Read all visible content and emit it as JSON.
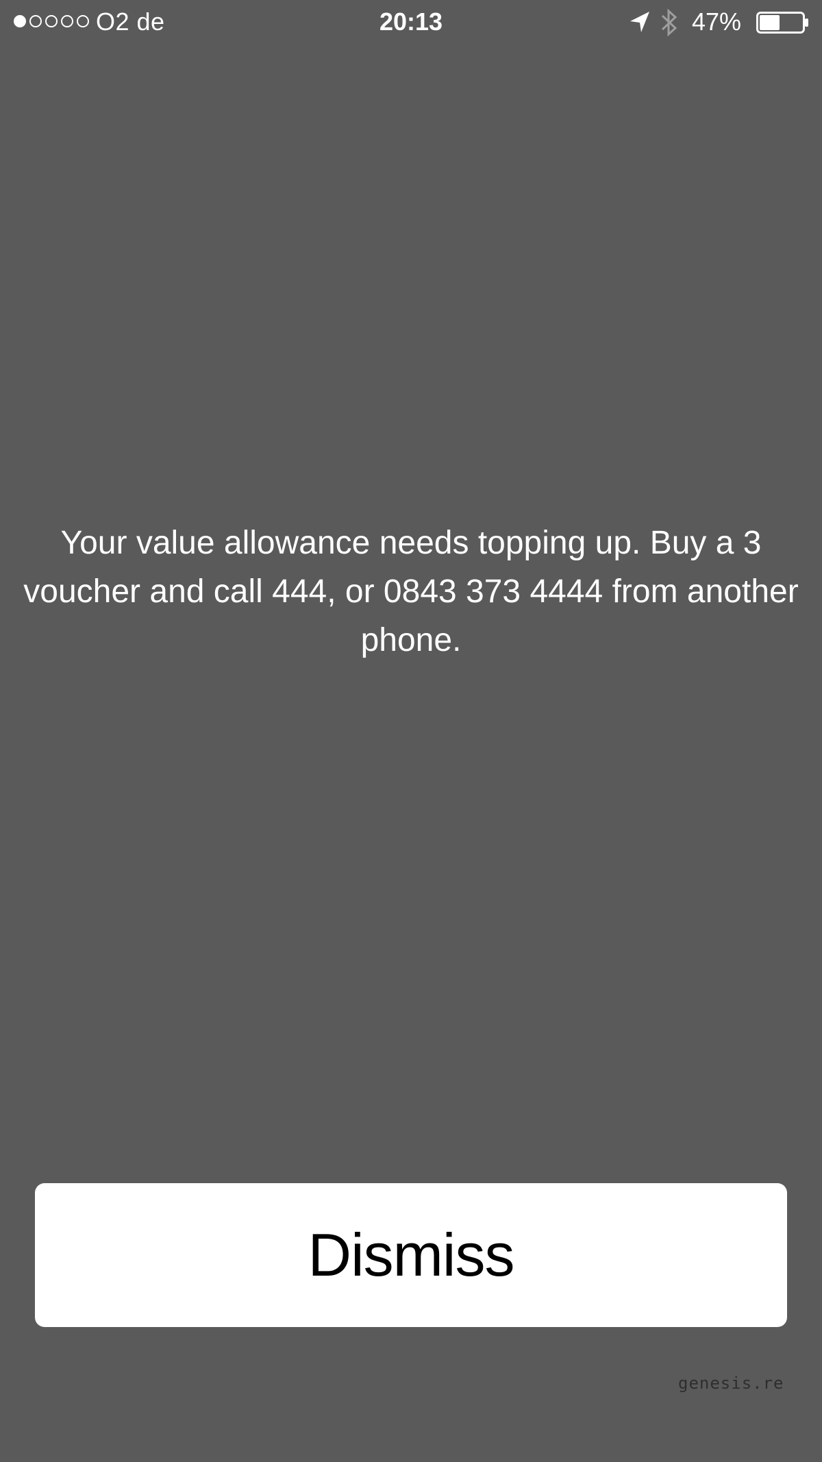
{
  "status_bar": {
    "signal_dots": [
      true,
      false,
      false,
      false,
      false
    ],
    "carrier": "O2 de",
    "time": "20:13",
    "location_icon": "location-arrow-icon",
    "bluetooth_icon": "bluetooth-icon",
    "battery_percent": "47%",
    "battery_level": 0.47
  },
  "alert": {
    "message": "Your value allowance needs topping up.  Buy a 3 voucher and call 444, or 0843 373 4444 from another phone.",
    "dismiss_label": "Dismiss"
  },
  "watermark": "genesis.re",
  "colors": {
    "background": "#5a5a5a",
    "button_background": "#ffffff",
    "text": "#ffffff"
  }
}
